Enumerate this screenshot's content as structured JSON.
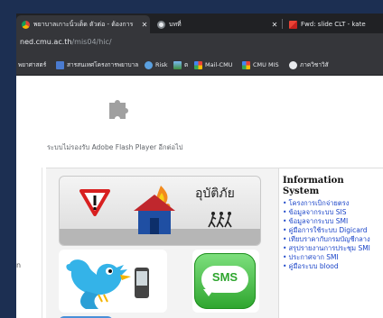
{
  "tabs": [
    {
      "title": "พยาบาลเกาะนิ้วเด็ด ตัวต่อ - ต้องการ",
      "close": "✕",
      "icon": "chrome-icon",
      "active": true
    },
    {
      "title": "บทที่",
      "close": "✕",
      "icon": "chrome-icon",
      "active": false
    },
    {
      "title": "Fwd: slide CLT - kate",
      "close": "✕",
      "icon": "gmail-icon",
      "active": false
    }
  ],
  "address_bar": {
    "host": "ned.cmu.ac.th",
    "path": "/mis04/hic/"
  },
  "bookmarks": [
    {
      "label": "พยาศาสตร์",
      "icon": "folder-icon"
    },
    {
      "label": "สารสนเทศโครงการพยาบาล",
      "icon": "table-icon"
    },
    {
      "label": "Risk",
      "icon": "person-icon"
    },
    {
      "label": "ต",
      "icon": "image-icon"
    },
    {
      "label": "Mail-CMU",
      "icon": "grid-icon"
    },
    {
      "label": "CMU MIS",
      "icon": "grid-icon"
    },
    {
      "label": "ภาควิชาวิสั",
      "icon": "chrome-icon"
    }
  ],
  "plugin": {
    "message": "ระบบไม่รองรับ Adobe Flash Player อีกต่อไป",
    "icon": "puzzle-icon"
  },
  "left_strip": {
    "text": "n"
  },
  "banners": {
    "accident_label": "อุบัติภัย",
    "sms_label": "SMS"
  },
  "info": {
    "title": "Information System",
    "items": [
      "โครงการเบิกจ่ายตรง",
      "ข้อมูลจากระบบ SIS",
      "ข้อมูลจากระบบ SMI",
      "คู่มือการใช้ระบบ Digicard",
      "เทียบราคากับกรมบัญชีกลาง",
      "สรุปรายงานการประชุม SMI",
      "ประกาศจาก SMI",
      "คู่มือระบบ blood"
    ]
  },
  "colors": {
    "accent_link": "#1a44c8",
    "sms_green": "#35b535",
    "tab_active": "#35363a"
  }
}
